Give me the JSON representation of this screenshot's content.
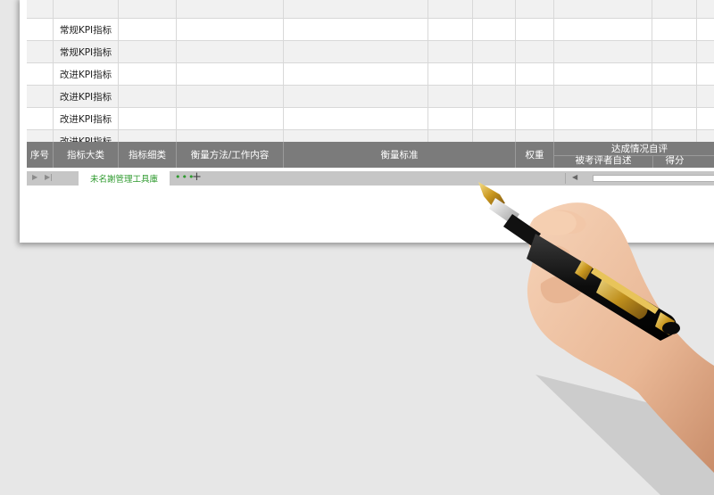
{
  "rows": [
    {
      "shade": true,
      "category": ""
    },
    {
      "shade": false,
      "category": "常规KPI指标"
    },
    {
      "shade": true,
      "category": "常规KPI指标"
    },
    {
      "shade": false,
      "category": "改进KPI指标"
    },
    {
      "shade": true,
      "category": "改进KPI指标"
    },
    {
      "shade": false,
      "category": "改进KPI指标"
    },
    {
      "shade": true,
      "category": "改进KPI指标"
    }
  ],
  "header": {
    "seq": "序号",
    "category": "指标大类",
    "subcategory": "指标细类",
    "method": "衡量方法/工作内容",
    "standard": "衡量标准",
    "weight": "权重",
    "self_eval": "达成情况自评",
    "self_desc": "被考评者自述",
    "score": "得分"
  },
  "tabbar": {
    "sheet_name": "未名謝管理工具庫",
    "more": "•••",
    "add": "+"
  },
  "colors": {
    "header_bg": "#7b7b7b",
    "shade_row": "#f1f1f1",
    "tab_text": "#2e9a2e"
  }
}
